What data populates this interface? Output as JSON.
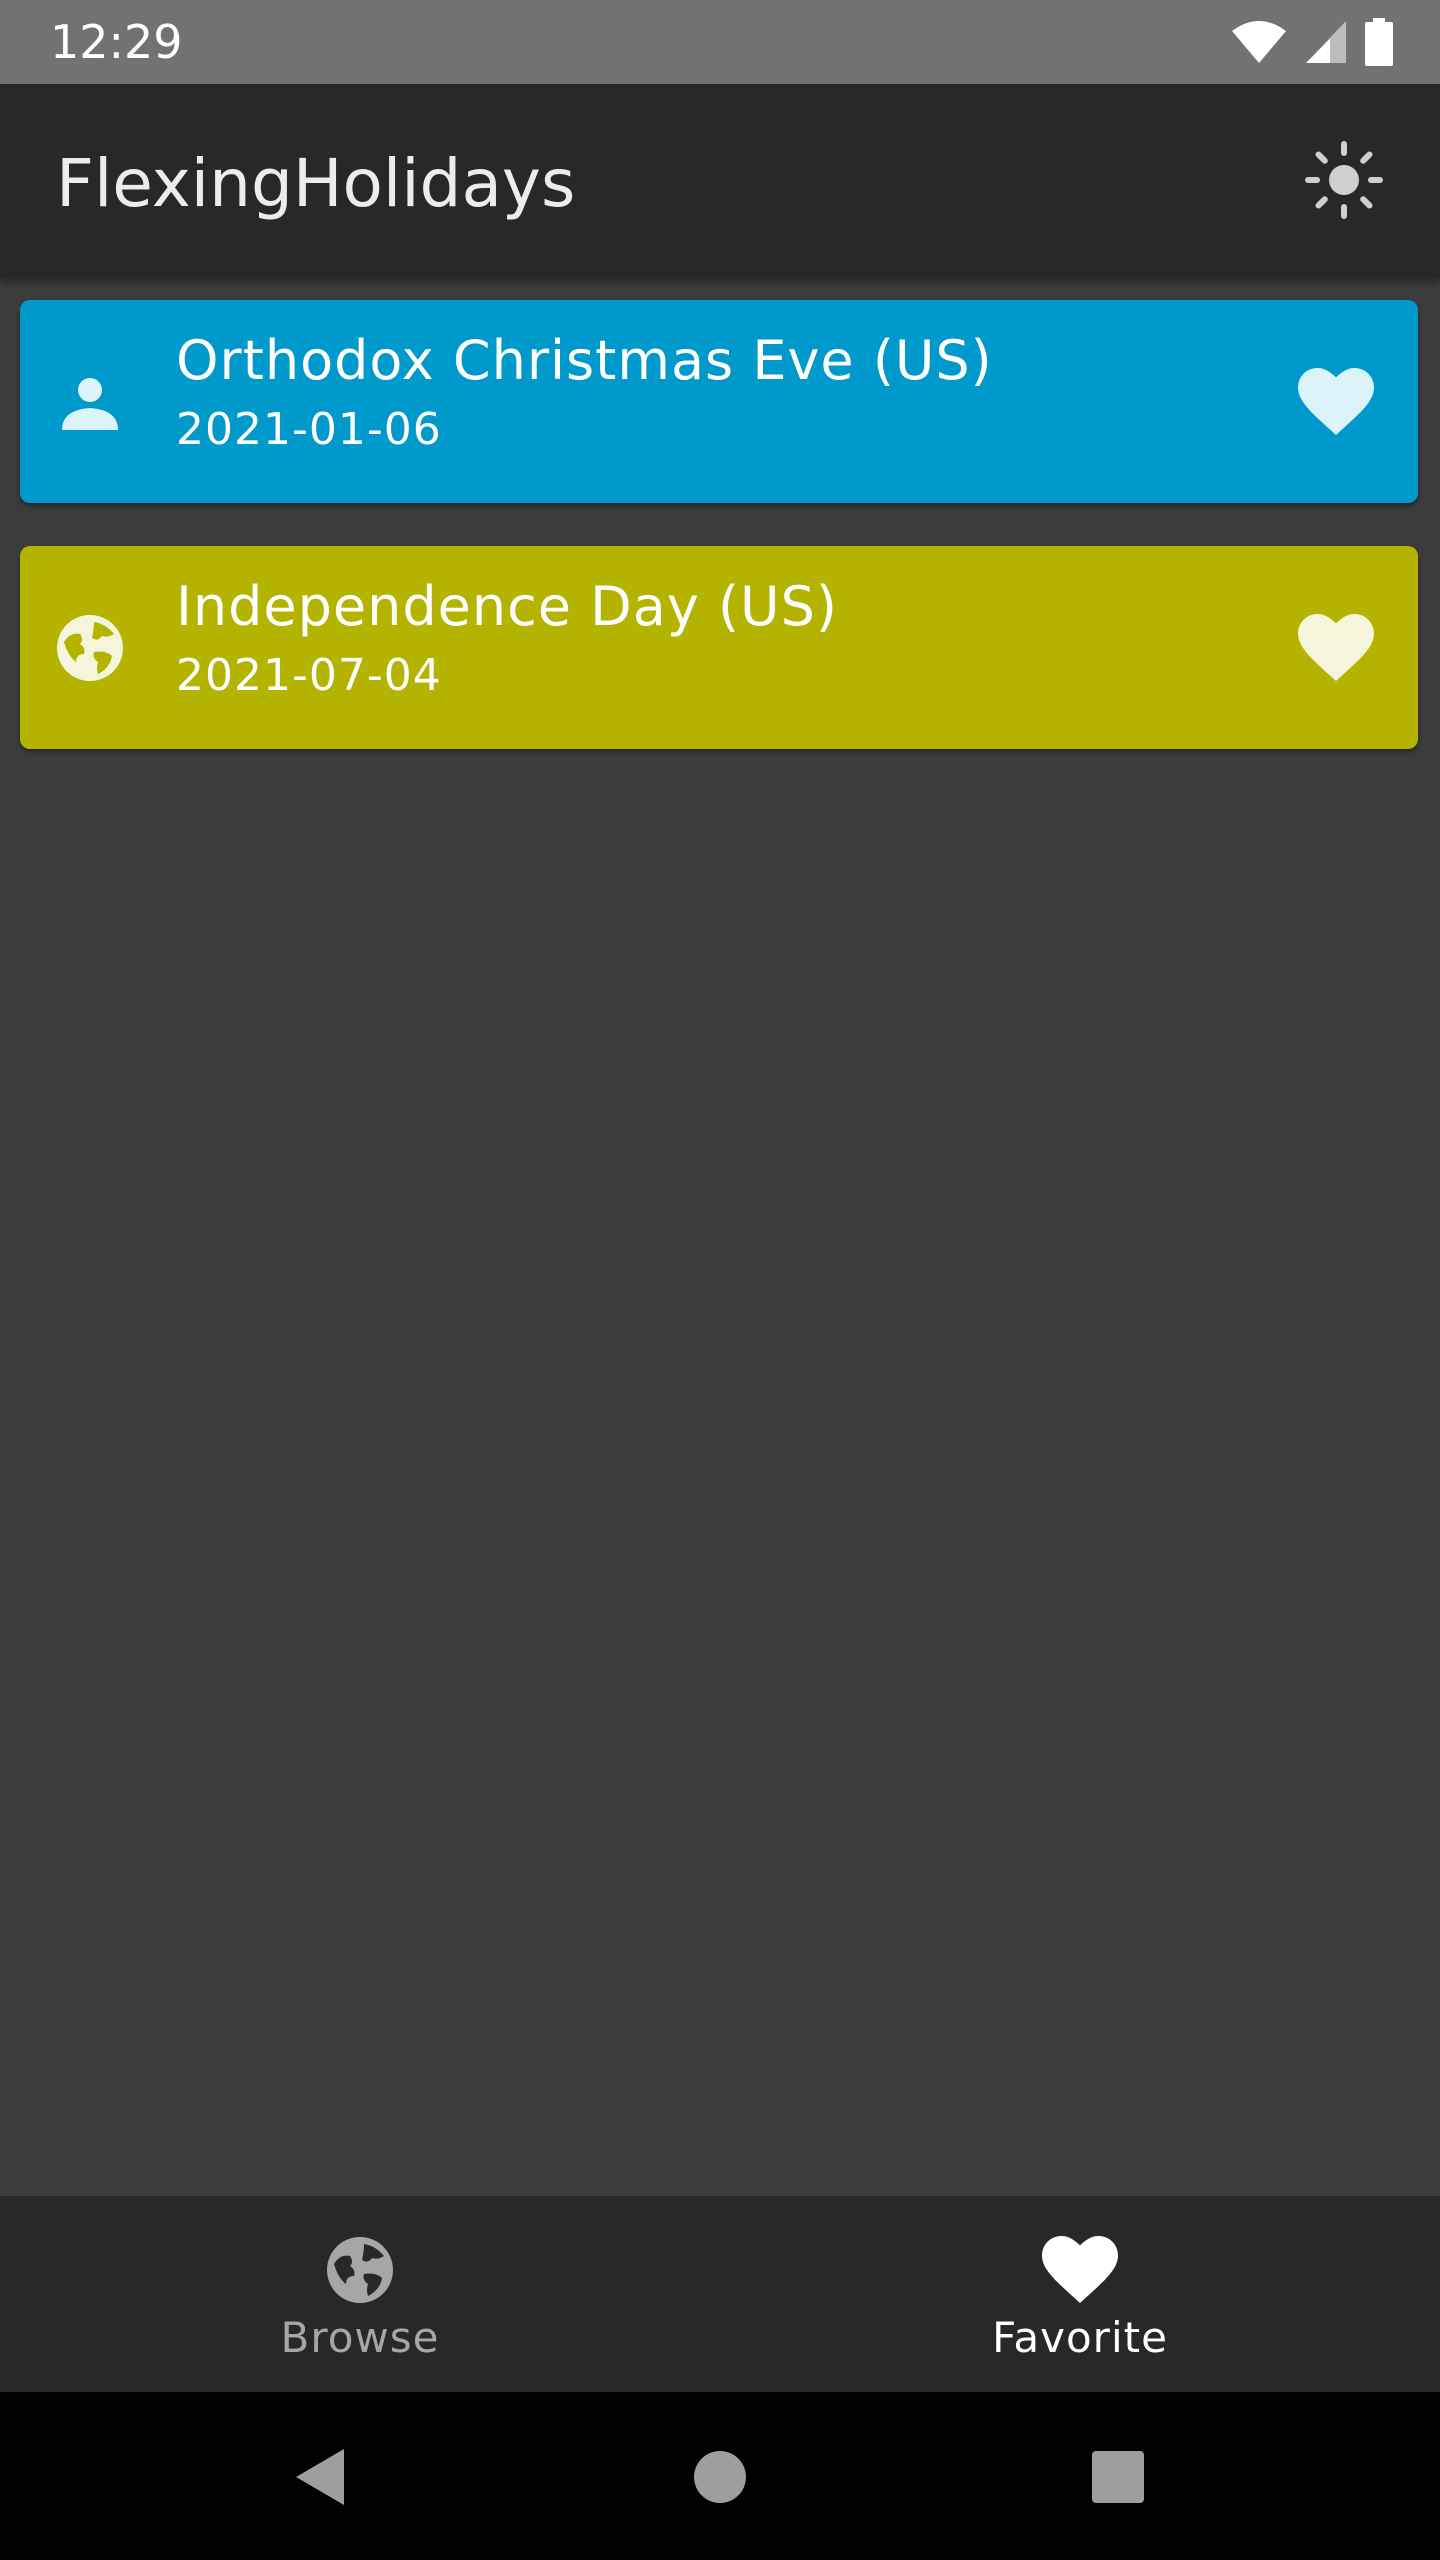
{
  "status_bar": {
    "time": "12:29",
    "icons": [
      "wifi-icon",
      "signal-icon",
      "battery-icon"
    ]
  },
  "app_bar": {
    "title": "FlexingHolidays",
    "action_icon": "sun-icon"
  },
  "holidays": [
    {
      "name": "Orthodox Christmas Eve (US)",
      "date": "2021-01-06",
      "type_icon": "person-icon",
      "favorite_icon": "heart-icon",
      "color": "#0099cc",
      "icon_tint": "#ddf3fa"
    },
    {
      "name": "Independence Day (US)",
      "date": "2021-07-04",
      "type_icon": "globe-icon",
      "favorite_icon": "heart-icon",
      "color": "#b3b300",
      "icon_tint": "#f5f5dc"
    }
  ],
  "bottom_nav": {
    "items": [
      {
        "label": "Browse",
        "icon": "globe-icon",
        "selected": false
      },
      {
        "label": "Favorite",
        "icon": "heart-icon",
        "selected": true
      }
    ],
    "selected_color": "#ffffff",
    "unselected_color": "#a6a6a6"
  },
  "system_nav": {
    "buttons": [
      "back-icon",
      "home-icon",
      "recents-icon"
    ]
  }
}
